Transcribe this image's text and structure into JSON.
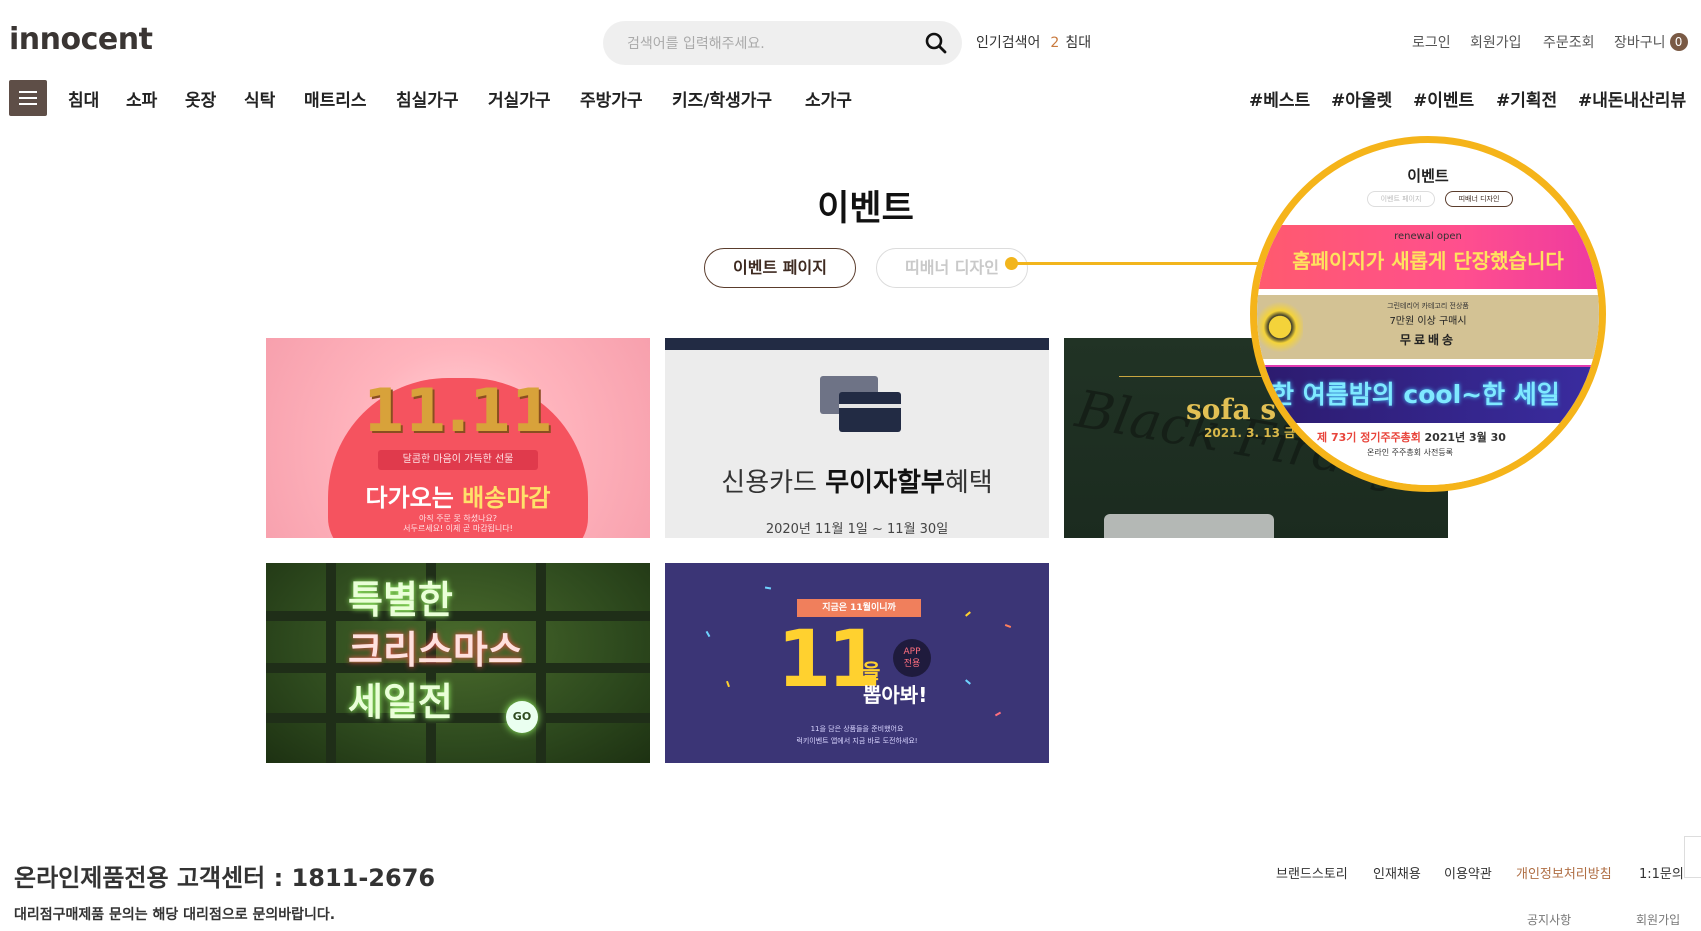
{
  "header": {
    "logo": "innocent",
    "search_placeholder": "검색어를 입력해주세요.",
    "popular_label": "인기검색어",
    "popular_rank": "2",
    "popular_term": "침대",
    "links": {
      "login": "로그인",
      "signup": "회원가입",
      "order_lookup": "주문조회",
      "cart": "장바구니",
      "cart_count": "0"
    }
  },
  "nav": {
    "categories": [
      "침대",
      "소파",
      "옷장",
      "식탁",
      "매트리스",
      "침실가구",
      "거실가구",
      "주방가구",
      "키즈/학생가구",
      "소가구"
    ],
    "hashtags": [
      "#베스트",
      "#아울렛",
      "#이벤트",
      "#기획전",
      "#내돈내산리뷰"
    ]
  },
  "main": {
    "title": "이벤트",
    "tabs": [
      {
        "label": "이벤트 페이지",
        "active": true
      },
      {
        "label": "띠배너 디자인",
        "active": false
      }
    ]
  },
  "cards": {
    "c1": {
      "number": "11.11",
      "sub": "달콤한 마음이 가득한 선물",
      "main_a": "다가오는",
      "main_b": "배송마감",
      "tiny1": "아직 주문 못 하셨나요?",
      "tiny2": "서두르세요! 이제 곧 마감됩니다!"
    },
    "c2": {
      "head_a": "신용카드",
      "head_b": "무이자할부",
      "head_c": "혜택",
      "date": "2020년 11월 1일 ~ 11월 30일"
    },
    "c3": {
      "script": "Black Firday",
      "title": "sofa s",
      "date": "2021. 3. 13 금"
    },
    "c4": {
      "line1": "특별한",
      "line2": "크리스마스",
      "line3": "세일전",
      "go": "GO"
    },
    "c5": {
      "ribbon": "지금은 11월이니까",
      "big": "11",
      "eul": "을",
      "pick": "뽑아봐!",
      "app1": "APP",
      "app2": "전용",
      "small1": "11을 담은 상품들을 준비했어요",
      "small2": "럭키이벤트 앱에서 지금 바로 도전하세요!"
    }
  },
  "magnifier": {
    "title": "이벤트",
    "tab_a": "이벤트 페이지",
    "tab_b": "띠배너 디자인",
    "band1_small": "renewal open",
    "band1_big": "홈페이지가 새롭게 단장했습니다",
    "band2_l1": "그린테리어 카테고리 전상품",
    "band2_l2": "7만원 이상 구매시",
    "band2_l3": "무료배송",
    "band3": "한 여름밤의 cool~한 세일",
    "band4_num": "제 73기 정기주주총회",
    "band4_date": "2021년 3월 30",
    "band4_sub": "온라인 주주총회 사전등록"
  },
  "footer": {
    "title": "온라인제품전용 고객센터 : 1811-2676",
    "note": "대리점구매제품 문의는 해당 대리점으로 문의바랍니다.",
    "links": [
      "브랜드스토리",
      "인재채용",
      "이용약관",
      "개인정보처리방침",
      "1:1문의"
    ],
    "links2": [
      "공지사항",
      "회원가입"
    ]
  },
  "colors": {
    "accent_brown": "#5e4e47",
    "highlight_yellow": "#f5b41a",
    "privacy_link": "#b06f45"
  }
}
